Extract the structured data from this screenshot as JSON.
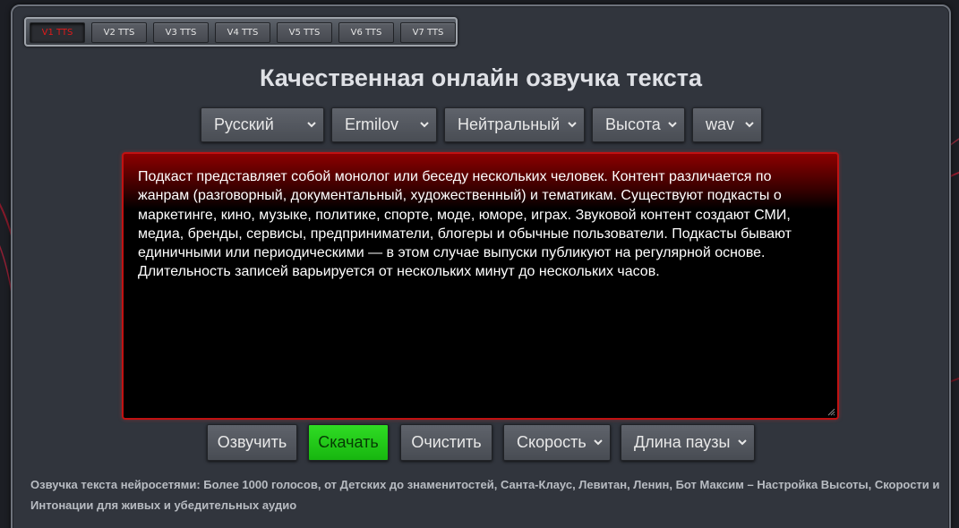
{
  "tabs": [
    {
      "label": "V1 TTS",
      "active": true
    },
    {
      "label": "V2 TTS",
      "active": false
    },
    {
      "label": "V3 TTS",
      "active": false
    },
    {
      "label": "V4 TTS",
      "active": false
    },
    {
      "label": "V5 TTS",
      "active": false
    },
    {
      "label": "V6 TTS",
      "active": false
    },
    {
      "label": "V7 TTS",
      "active": false
    }
  ],
  "title": "Качественная онлайн озвучка текста",
  "selects": {
    "language": "Русский",
    "voice": "Ermilov",
    "emotion": "Нейтральный",
    "pitch": "Высота",
    "format": "wav"
  },
  "editor_text": "Подкаст представляет собой монолог или беседу нескольких человек. Контент различается по жанрам (разговорный, документальный, художественный) и тематикам. Существуют подкасты о маркетинге, кино, музыке, политике, спорте, моде, юморе, играх. Звуковой контент создают СМИ, медиа, бренды, сервисы, предприниматели, блогеры и обычные пользователи. Подкасты бывают единичными или периодическими — в этом случае выпуски публикуют на регулярной основе. Длительность записей варьируется от нескольких минут до нескольких часов.",
  "buttons": {
    "speak": "Озвучить",
    "download": "Скачать",
    "clear": "Очистить",
    "speed": "Скорость",
    "pause": "Длина паузы"
  },
  "footer": "Озвучка текста нейросетями: Более 1000 голосов, от Детских до знаменитостей, Санта-Клаус, Левитан, Ленин, Бот Максим – Настройка Высоты, Скорости и Интонации для живых и убедительных аудио",
  "colors": {
    "accent_red": "#c01212",
    "download_green": "#2fdc24",
    "panel": "#31353d"
  }
}
